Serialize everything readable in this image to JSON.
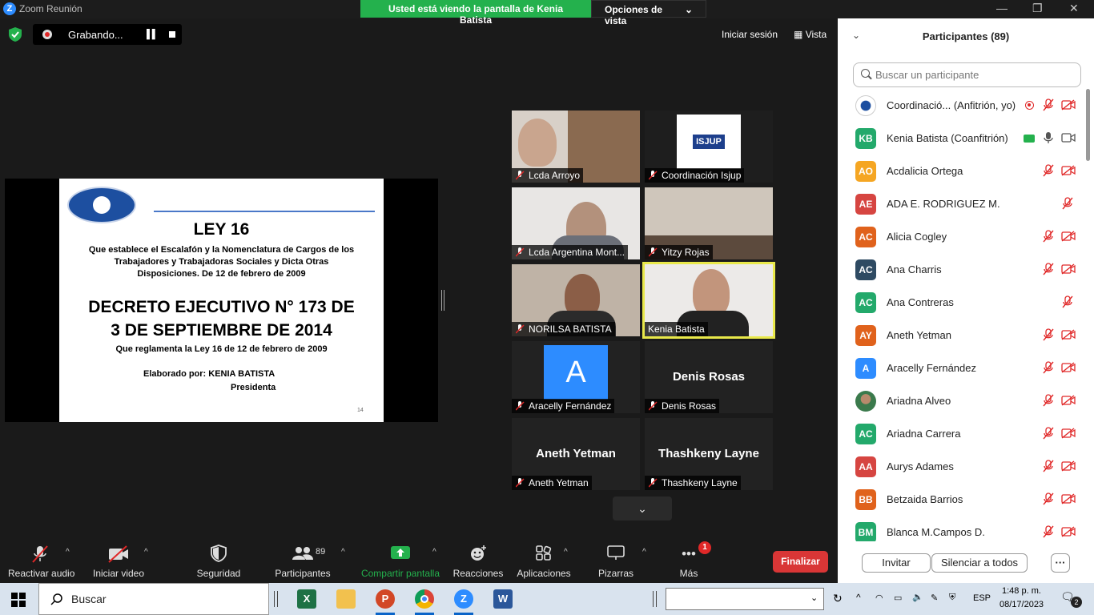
{
  "window": {
    "title": "Zoom Reunión",
    "logo": "Z",
    "banner_text": "Usted está viendo la pantalla de Kenia Batista",
    "view_options": "Opciones de vista"
  },
  "recording": {
    "label": "Grabando..."
  },
  "top_right": {
    "sign_in": "Iniciar sesión",
    "view": "Vista"
  },
  "slide": {
    "title": "LEY 16",
    "subtitle": "Que establece el Escalafón y la Nomenclatura de Cargos de los Trabajadores y Trabajadoras Sociales y Dicta Otras Disposiciones. De 12 de febrero de 2009",
    "decree_line1": "DECRETO EJECUTIVO N° 173 DE",
    "decree_line2": "3 DE SEPTIEMBRE DE 2014",
    "regulation": "Que reglamenta la Ley 16 de 12 de febrero de 2009",
    "author": "Elaborado por:  KENIA BATISTA",
    "role": "Presidenta",
    "page_number": "14"
  },
  "gallery": {
    "tiles": [
      {
        "name": "Lcda Arroyo"
      },
      {
        "name": "Coordinación Isjup",
        "logo_text": "ISJUP"
      },
      {
        "name": "Lcda Argentina Mont..."
      },
      {
        "name": "Yitzy Rojas"
      },
      {
        "name": "NORILSA BATISTA"
      },
      {
        "name": "Kenia Batista"
      },
      {
        "name": "Aracelly Fernández",
        "initial": "A"
      },
      {
        "name": "Denis Rosas",
        "big_name": "Denis Rosas"
      },
      {
        "name": "Aneth Yetman",
        "big_name": "Aneth Yetman"
      },
      {
        "name": "Thashkeny Layne",
        "big_name": "Thashkeny Layne"
      }
    ]
  },
  "toolbar": {
    "audio": "Reactivar audio",
    "video": "Iniciar video",
    "security": "Seguridad",
    "participants": "Participantes",
    "participants_count": "89",
    "share": "Compartir pantalla",
    "reactions": "Reacciones",
    "apps": "Aplicaciones",
    "whiteboards": "Pizarras",
    "more": "Más",
    "more_badge": "1",
    "end": "Finalizar"
  },
  "panel": {
    "title": "Participantes (89)",
    "search_placeholder": "Buscar un participante",
    "invite": "Invitar",
    "mute_all": "Silenciar a todos",
    "more": "···",
    "participants": [
      {
        "name": "Coordinació...  (Anfitrión, yo)",
        "initials": "",
        "color": "#ffffff"
      },
      {
        "name": "Kenia Batista (Coanfitrión)",
        "initials": "KB",
        "color": "#23a96b"
      },
      {
        "name": "Acdalicia Ortega",
        "initials": "AO",
        "color": "#f5a623"
      },
      {
        "name": "ADA E. RODRIGUEZ M.",
        "initials": "AE",
        "color": "#d64541"
      },
      {
        "name": "Alicia Cogley",
        "initials": "AC",
        "color": "#e0621c"
      },
      {
        "name": "Ana Charris",
        "initials": "AC",
        "color": "#2e4a62"
      },
      {
        "name": "Ana Contreras",
        "initials": "AC",
        "color": "#23a96b"
      },
      {
        "name": "Aneth Yetman",
        "initials": "AY",
        "color": "#e0621c"
      },
      {
        "name": "Aracelly Fernández",
        "initials": "A",
        "color": "#2d8cff"
      },
      {
        "name": "Ariadna Alveo",
        "initials": "",
        "color": "#2e8b57"
      },
      {
        "name": "Ariadna Carrera",
        "initials": "AC",
        "color": "#23a96b"
      },
      {
        "name": "Aurys Adames",
        "initials": "AA",
        "color": "#d64541"
      },
      {
        "name": "Betzaida Barrios",
        "initials": "BB",
        "color": "#e0621c"
      },
      {
        "name": "Blanca M.Campos D.",
        "initials": "BM",
        "color": "#23a96b"
      }
    ]
  },
  "taskbar": {
    "search": "Buscar",
    "time": "1:48 p. m.",
    "date": "08/17/2023",
    "lang": "ESP",
    "notif_count": "2"
  }
}
